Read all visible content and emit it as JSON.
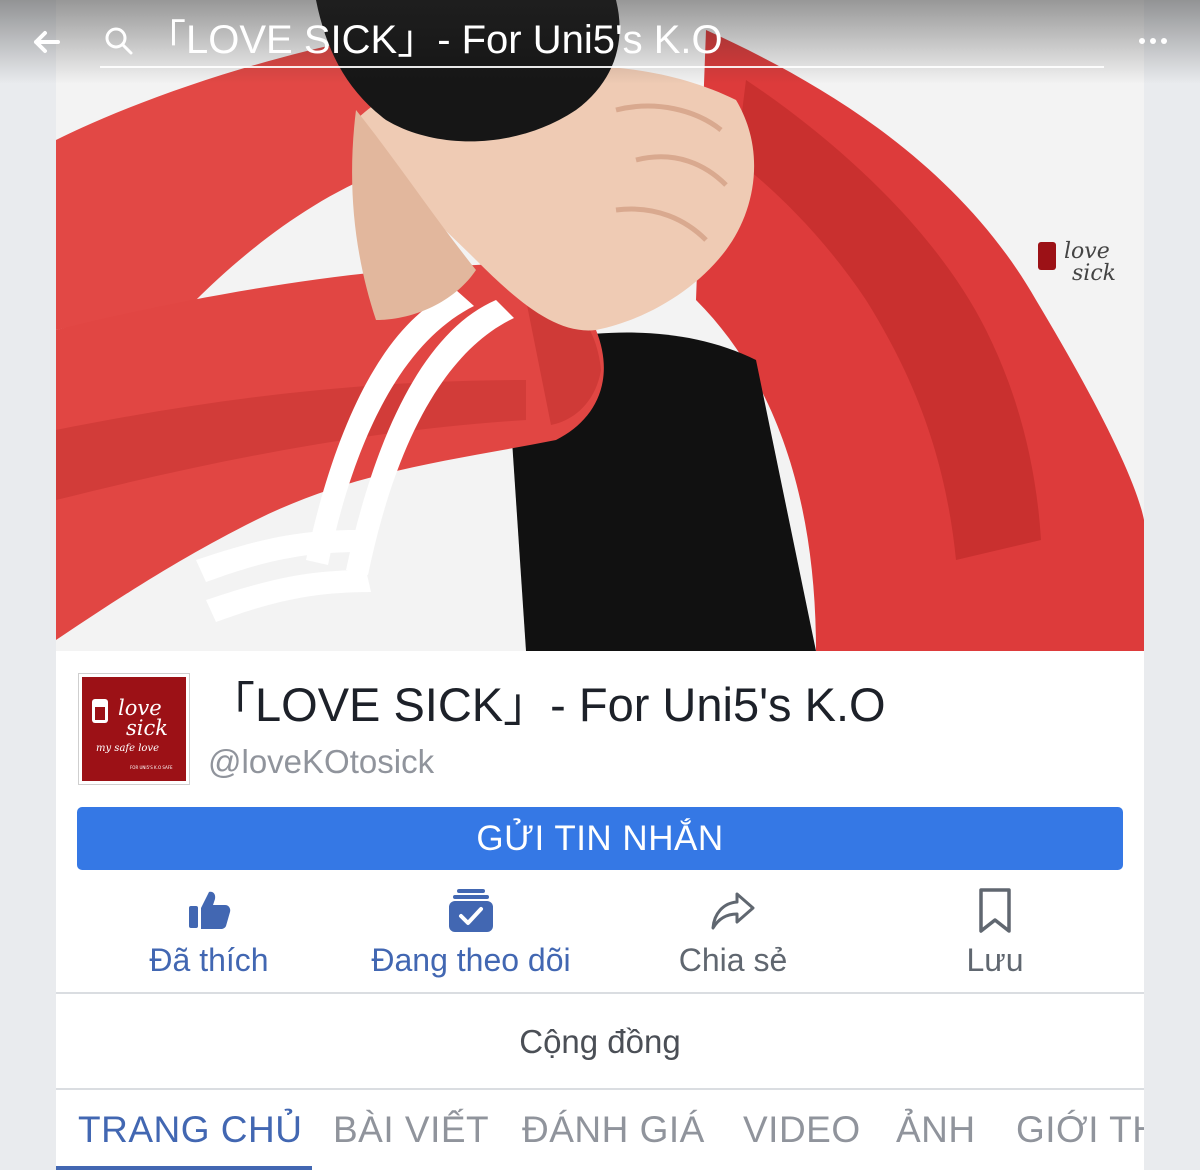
{
  "search": {
    "query": "「LOVE SICK」- For Uni5's K.O"
  },
  "cover": {
    "watermark_line1": "love",
    "watermark_line2": "sick"
  },
  "profile": {
    "logo_line1": "love",
    "logo_line2": "sick",
    "logo_script": "my safe love",
    "logo_small": "FOR UNI5'S K.O SAFE",
    "title": "「LOVE SICK」- For Uni5's K.O",
    "handle": "@loveKOtosick"
  },
  "buttons": {
    "message": "GỬI TIN NHẮN"
  },
  "actions": [
    {
      "label": "Đã thích",
      "icon": "thumbs-up-icon"
    },
    {
      "label": "Đang theo dõi",
      "icon": "following-check-icon"
    },
    {
      "label": "Chia sẻ",
      "icon": "share-arrow-icon"
    },
    {
      "label": "Lưu",
      "icon": "bookmark-icon"
    }
  ],
  "community": "Cộng đồng",
  "tabs": [
    {
      "label": "TRANG CHỦ",
      "active": true
    },
    {
      "label": "BÀI VIẾT",
      "active": false
    },
    {
      "label": "ĐÁNH GIÁ",
      "active": false
    },
    {
      "label": "VIDEO",
      "active": false
    },
    {
      "label": "ẢNH",
      "active": false
    },
    {
      "label": "GIỚI THIỆU",
      "active": false
    }
  ],
  "colors": {
    "accent": "#4267b2",
    "button": "#3578e5",
    "jacket": "#e0403f",
    "logo_bg": "#9c1116"
  }
}
